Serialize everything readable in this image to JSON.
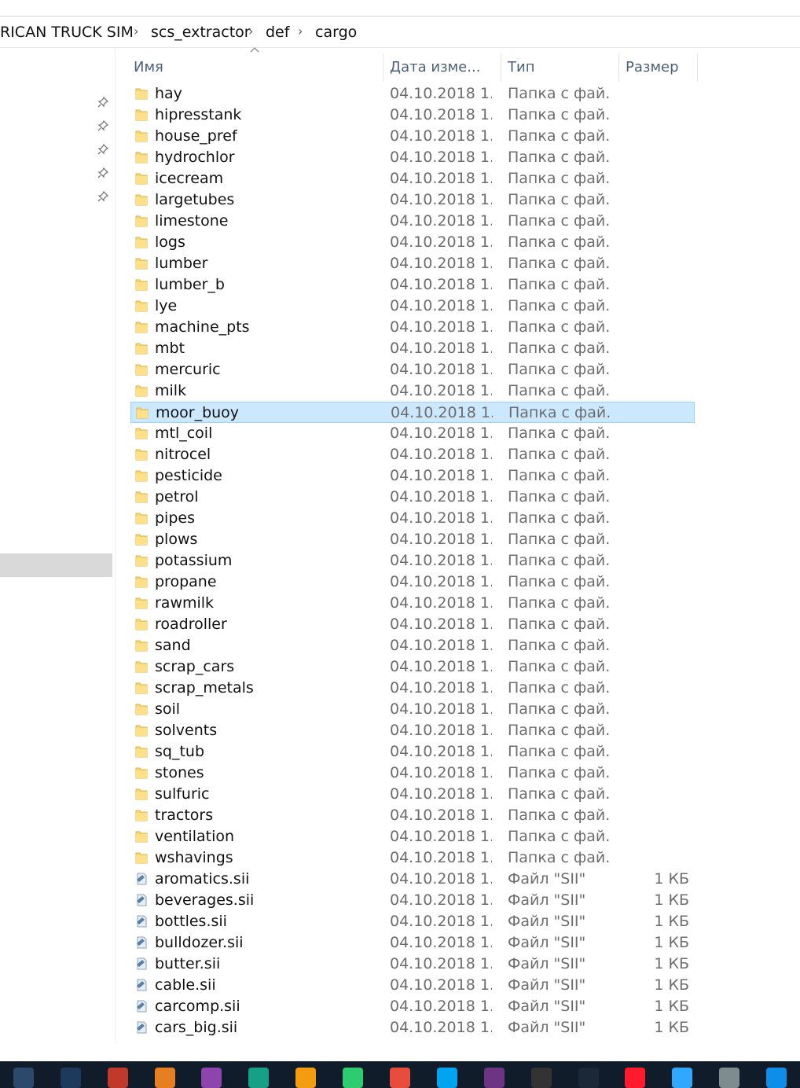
{
  "breadcrumb": {
    "items": [
      "RICAN TRUCK SIM",
      "scs_extractor",
      "def",
      "cargo"
    ]
  },
  "columns": {
    "name": "Имя",
    "date": "Дата изме...",
    "type": "Тип",
    "size": "Размер"
  },
  "selected_index": 15,
  "rows": [
    {
      "name": "hay",
      "date": "04.10.2018 1...",
      "type": "Папка с фай...",
      "size": "",
      "kind": "folder"
    },
    {
      "name": "hipresstank",
      "date": "04.10.2018 1...",
      "type": "Папка с фай...",
      "size": "",
      "kind": "folder"
    },
    {
      "name": "house_pref",
      "date": "04.10.2018 1...",
      "type": "Папка с фай...",
      "size": "",
      "kind": "folder"
    },
    {
      "name": "hydrochlor",
      "date": "04.10.2018 1...",
      "type": "Папка с фай...",
      "size": "",
      "kind": "folder"
    },
    {
      "name": "icecream",
      "date": "04.10.2018 1...",
      "type": "Папка с фай...",
      "size": "",
      "kind": "folder"
    },
    {
      "name": "largetubes",
      "date": "04.10.2018 1...",
      "type": "Папка с фай...",
      "size": "",
      "kind": "folder"
    },
    {
      "name": "limestone",
      "date": "04.10.2018 1...",
      "type": "Папка с фай...",
      "size": "",
      "kind": "folder"
    },
    {
      "name": "logs",
      "date": "04.10.2018 1...",
      "type": "Папка с фай...",
      "size": "",
      "kind": "folder"
    },
    {
      "name": "lumber",
      "date": "04.10.2018 1...",
      "type": "Папка с фай...",
      "size": "",
      "kind": "folder"
    },
    {
      "name": "lumber_b",
      "date": "04.10.2018 1...",
      "type": "Папка с фай...",
      "size": "",
      "kind": "folder"
    },
    {
      "name": "lye",
      "date": "04.10.2018 1...",
      "type": "Папка с фай...",
      "size": "",
      "kind": "folder"
    },
    {
      "name": "machine_pts",
      "date": "04.10.2018 1...",
      "type": "Папка с фай...",
      "size": "",
      "kind": "folder"
    },
    {
      "name": "mbt",
      "date": "04.10.2018 1...",
      "type": "Папка с фай...",
      "size": "",
      "kind": "folder"
    },
    {
      "name": "mercuric",
      "date": "04.10.2018 1...",
      "type": "Папка с фай...",
      "size": "",
      "kind": "folder"
    },
    {
      "name": "milk",
      "date": "04.10.2018 1...",
      "type": "Папка с фай...",
      "size": "",
      "kind": "folder"
    },
    {
      "name": "moor_buoy",
      "date": "04.10.2018 1...",
      "type": "Папка с фай...",
      "size": "",
      "kind": "folder"
    },
    {
      "name": "mtl_coil",
      "date": "04.10.2018 1...",
      "type": "Папка с фай...",
      "size": "",
      "kind": "folder"
    },
    {
      "name": "nitrocel",
      "date": "04.10.2018 1...",
      "type": "Папка с фай...",
      "size": "",
      "kind": "folder"
    },
    {
      "name": "pesticide",
      "date": "04.10.2018 1...",
      "type": "Папка с фай...",
      "size": "",
      "kind": "folder"
    },
    {
      "name": "petrol",
      "date": "04.10.2018 1...",
      "type": "Папка с фай...",
      "size": "",
      "kind": "folder"
    },
    {
      "name": "pipes",
      "date": "04.10.2018 1...",
      "type": "Папка с фай...",
      "size": "",
      "kind": "folder"
    },
    {
      "name": "plows",
      "date": "04.10.2018 1...",
      "type": "Папка с фай...",
      "size": "",
      "kind": "folder"
    },
    {
      "name": "potassium",
      "date": "04.10.2018 1...",
      "type": "Папка с фай...",
      "size": "",
      "kind": "folder"
    },
    {
      "name": "propane",
      "date": "04.10.2018 1...",
      "type": "Папка с фай...",
      "size": "",
      "kind": "folder"
    },
    {
      "name": "rawmilk",
      "date": "04.10.2018 1...",
      "type": "Папка с фай...",
      "size": "",
      "kind": "folder"
    },
    {
      "name": "roadroller",
      "date": "04.10.2018 1...",
      "type": "Папка с фай...",
      "size": "",
      "kind": "folder"
    },
    {
      "name": "sand",
      "date": "04.10.2018 1...",
      "type": "Папка с фай...",
      "size": "",
      "kind": "folder"
    },
    {
      "name": "scrap_cars",
      "date": "04.10.2018 1...",
      "type": "Папка с фай...",
      "size": "",
      "kind": "folder"
    },
    {
      "name": "scrap_metals",
      "date": "04.10.2018 1...",
      "type": "Папка с фай...",
      "size": "",
      "kind": "folder"
    },
    {
      "name": "soil",
      "date": "04.10.2018 1...",
      "type": "Папка с фай...",
      "size": "",
      "kind": "folder"
    },
    {
      "name": "solvents",
      "date": "04.10.2018 1...",
      "type": "Папка с фай...",
      "size": "",
      "kind": "folder"
    },
    {
      "name": "sq_tub",
      "date": "04.10.2018 1...",
      "type": "Папка с фай...",
      "size": "",
      "kind": "folder"
    },
    {
      "name": "stones",
      "date": "04.10.2018 1...",
      "type": "Папка с фай...",
      "size": "",
      "kind": "folder"
    },
    {
      "name": "sulfuric",
      "date": "04.10.2018 1...",
      "type": "Папка с фай...",
      "size": "",
      "kind": "folder"
    },
    {
      "name": "tractors",
      "date": "04.10.2018 1...",
      "type": "Папка с фай...",
      "size": "",
      "kind": "folder"
    },
    {
      "name": "ventilation",
      "date": "04.10.2018 1...",
      "type": "Папка с фай...",
      "size": "",
      "kind": "folder"
    },
    {
      "name": "wshavings",
      "date": "04.10.2018 1...",
      "type": "Папка с фай...",
      "size": "",
      "kind": "folder"
    },
    {
      "name": "aromatics.sii",
      "date": "04.10.2018 1...",
      "type": "Файл \"SII\"",
      "size": "1 КБ",
      "kind": "file"
    },
    {
      "name": "beverages.sii",
      "date": "04.10.2018 1...",
      "type": "Файл \"SII\"",
      "size": "1 КБ",
      "kind": "file"
    },
    {
      "name": "bottles.sii",
      "date": "04.10.2018 1...",
      "type": "Файл \"SII\"",
      "size": "1 КБ",
      "kind": "file"
    },
    {
      "name": "bulldozer.sii",
      "date": "04.10.2018 1...",
      "type": "Файл \"SII\"",
      "size": "1 КБ",
      "kind": "file"
    },
    {
      "name": "butter.sii",
      "date": "04.10.2018 1...",
      "type": "Файл \"SII\"",
      "size": "1 КБ",
      "kind": "file"
    },
    {
      "name": "cable.sii",
      "date": "04.10.2018 1...",
      "type": "Файл \"SII\"",
      "size": "1 КБ",
      "kind": "file"
    },
    {
      "name": "carcomp.sii",
      "date": "04.10.2018 1...",
      "type": "Файл \"SII\"",
      "size": "1 КБ",
      "kind": "file"
    },
    {
      "name": "cars_big.sii",
      "date": "04.10.2018 1...",
      "type": "Файл \"SII\"",
      "size": "1 КБ",
      "kind": "file"
    }
  ],
  "taskbar": {
    "icons": [
      {
        "name": "app-icon",
        "color": "#2b4a6b"
      },
      {
        "name": "euro-icon",
        "color": "#1d3a5c"
      },
      {
        "name": "paint-icon",
        "color": "#c0392b"
      },
      {
        "name": "flash-icon",
        "color": "#e67e22"
      },
      {
        "name": "balloon-icon",
        "color": "#8e44ad"
      },
      {
        "name": "plane-icon",
        "color": "#16a085"
      },
      {
        "name": "player-icon",
        "color": "#f39c12"
      },
      {
        "name": "utorrent-icon",
        "color": "#2ecc71"
      },
      {
        "name": "chrome-icon",
        "color": "#e74c3c"
      },
      {
        "name": "windows-icon",
        "color": "#00a4ef"
      },
      {
        "name": "cpu-icon",
        "color": "#6c3483"
      },
      {
        "name": "gpu-icon",
        "color": "#333333"
      },
      {
        "name": "steam-icon",
        "color": "#1b2838"
      },
      {
        "name": "opera-icon",
        "color": "#ff1b2d"
      },
      {
        "name": "photoshop-icon",
        "color": "#31a8ff"
      },
      {
        "name": "printer-icon",
        "color": "#7f8c8d"
      },
      {
        "name": "teamviewer-icon",
        "color": "#0e8ee9"
      }
    ]
  }
}
